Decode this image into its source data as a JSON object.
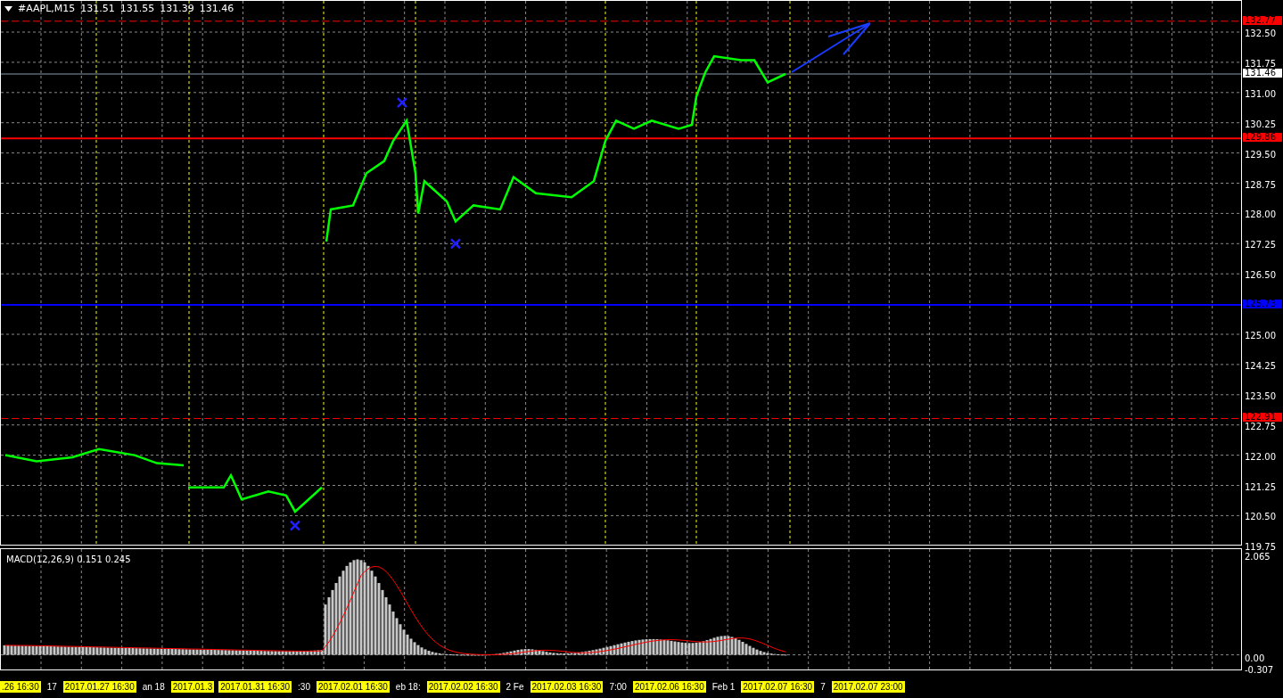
{
  "chart": {
    "symbol": "#AAPL,M15",
    "ohlc": [
      "131.51",
      "131.55",
      "131.39",
      "131.46"
    ],
    "price_ticks": [
      "132.50",
      "131.75",
      "131.00",
      "130.25",
      "129.50",
      "128.75",
      "128.00",
      "127.25",
      "126.50",
      "125.00",
      "124.25",
      "123.50",
      "122.75",
      "122.00",
      "121.25",
      "120.50",
      "119.75"
    ],
    "levels": [
      {
        "price": "132.77",
        "color": "#ff0000",
        "kind": "dashed"
      },
      {
        "price": "129.86",
        "color": "#ff0000",
        "kind": "solid"
      },
      {
        "price": "125.73",
        "color": "#0000ff",
        "kind": "solid"
      },
      {
        "price": "122.91",
        "color": "#ff0000",
        "kind": "dashed"
      }
    ],
    "current_price": "131.46"
  },
  "macd": {
    "title": "MACD(12,26,9) 0.151 0.245",
    "ticks": [
      "2.065",
      "0.00",
      "-0.307"
    ]
  },
  "time_axis": {
    "labels": [
      {
        "text": ".26 16:30",
        "kind": "tag"
      },
      {
        "text": "17",
        "kind": "plain"
      },
      {
        "text": "2017.01.27 16:30",
        "kind": "tag"
      },
      {
        "text": "an 18",
        "kind": "plain"
      },
      {
        "text": "2017.01.3",
        "kind": "tag"
      },
      {
        "text": "2017.01.31 16:30",
        "kind": "tag"
      },
      {
        "text": ":30",
        "kind": "plain"
      },
      {
        "text": "2017.02.01 16:30",
        "kind": "tag"
      },
      {
        "text": "eb 18:",
        "kind": "plain"
      },
      {
        "text": "2017.02.02 16:30",
        "kind": "tag"
      },
      {
        "text": "2 Fe",
        "kind": "plain"
      },
      {
        "text": "2017.02.03 16:30",
        "kind": "tag"
      },
      {
        "text": "7:00",
        "kind": "plain"
      },
      {
        "text": "2017.02.06 16:30",
        "kind": "tag"
      },
      {
        "text": "Feb 1",
        "kind": "plain"
      },
      {
        "text": "2017.02.07 16:30",
        "kind": "tag"
      },
      {
        "text": "7",
        "kind": "plain"
      },
      {
        "text": "2017.02.07 23:00",
        "kind": "tag"
      }
    ]
  }
}
